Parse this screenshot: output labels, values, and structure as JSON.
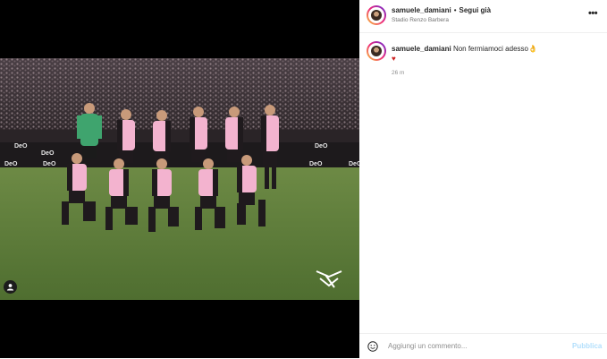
{
  "post": {
    "username": "samuele_damiani",
    "separator": "•",
    "follow_label": "Segui già",
    "location": "Stadio Renzo Barbera",
    "more_icon": "more-horizontal-icon"
  },
  "caption": {
    "username": "samuele_damiani",
    "text": "Non fermiamoci adesso👌",
    "line2": "♥",
    "time": "26 m"
  },
  "comment": {
    "placeholder": "Aggiungi un commento...",
    "publish_label": "Pubblica"
  },
  "colors": {
    "pink_kit": "#f3b3cf",
    "dark_kit": "#1f1a1d",
    "keeper_kit": "#3fa46e",
    "pitch": "#5f7f3a",
    "publish_disabled": "#b2dffc"
  }
}
